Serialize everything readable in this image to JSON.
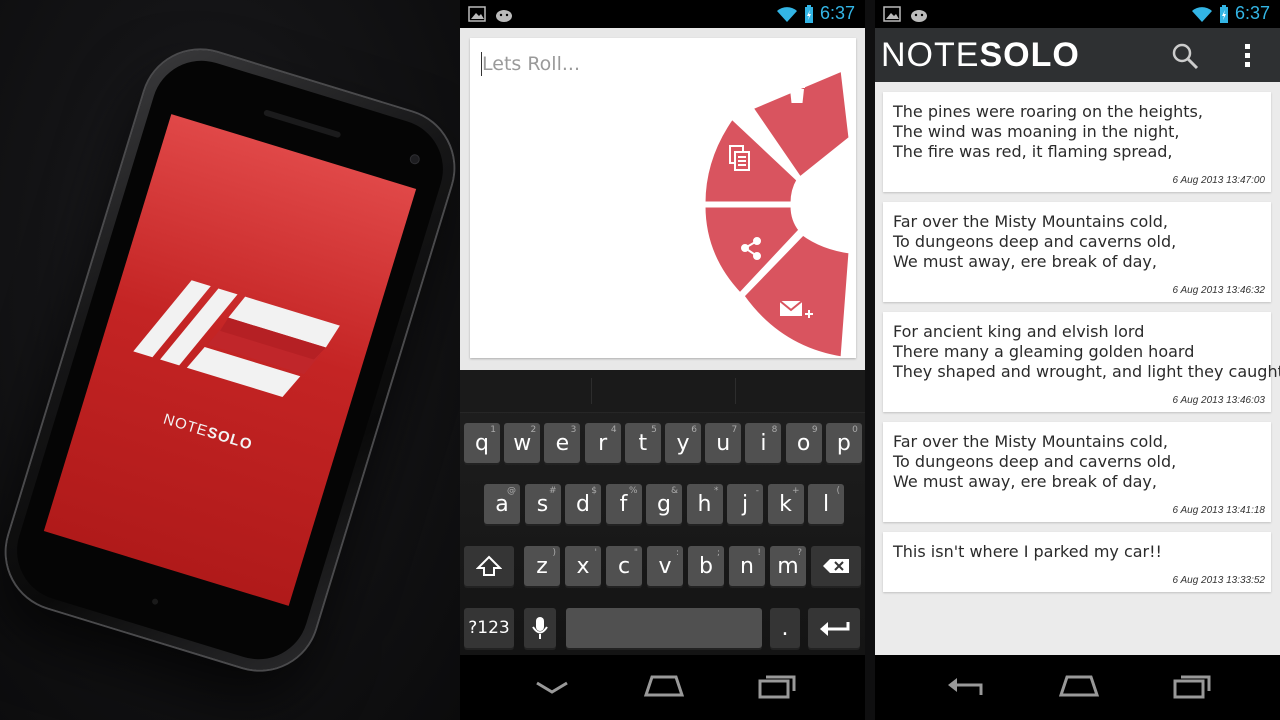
{
  "phone_screen": {
    "brand_light": "NOTE",
    "brand_bold": "SOLO"
  },
  "status_bar": {
    "time": "6:37"
  },
  "editor": {
    "placeholder": "Lets Roll...",
    "radial_menu": [
      "trash-icon",
      "copy-icon",
      "share-icon",
      "email-add-icon"
    ]
  },
  "keyboard": {
    "row1": [
      {
        "k": "q",
        "s": "1"
      },
      {
        "k": "w",
        "s": "2"
      },
      {
        "k": "e",
        "s": "3"
      },
      {
        "k": "r",
        "s": "4"
      },
      {
        "k": "t",
        "s": "5"
      },
      {
        "k": "y",
        "s": "6"
      },
      {
        "k": "u",
        "s": "7"
      },
      {
        "k": "i",
        "s": "8"
      },
      {
        "k": "o",
        "s": "9"
      },
      {
        "k": "p",
        "s": "0"
      }
    ],
    "row2": [
      {
        "k": "a",
        "s": "@"
      },
      {
        "k": "s",
        "s": "#"
      },
      {
        "k": "d",
        "s": "$"
      },
      {
        "k": "f",
        "s": "%"
      },
      {
        "k": "g",
        "s": "&"
      },
      {
        "k": "h",
        "s": "*"
      },
      {
        "k": "j",
        "s": "-"
      },
      {
        "k": "k",
        "s": "+"
      },
      {
        "k": "l",
        "s": "("
      }
    ],
    "row3": [
      {
        "k": "z",
        "s": ")"
      },
      {
        "k": "x",
        "s": "'"
      },
      {
        "k": "c",
        "s": "\""
      },
      {
        "k": "v",
        "s": ":"
      },
      {
        "k": "b",
        "s": ";"
      },
      {
        "k": "n",
        "s": "!"
      },
      {
        "k": "m",
        "s": "?"
      }
    ],
    "symbols_label": "?123",
    "period_label": "."
  },
  "list_app": {
    "title_light": "NOTE",
    "title_bold": "SOLO",
    "notes": [
      {
        "text": "The pines were roaring on the heights,\nThe wind was moaning in the night,\nThe fire was red, it flaming spread,",
        "date": "6 Aug 2013 13:47:00"
      },
      {
        "text": "Far over the Misty Mountains cold,\nTo dungeons deep and caverns old,\nWe must away, ere break of day,",
        "date": "6 Aug 2013 13:46:32"
      },
      {
        "text": "For ancient king and elvish lord\nThere many a gleaming golden hoard\nThey shaped and wrought, and light they caught,",
        "date": "6 Aug 2013 13:46:03"
      },
      {
        "text": "Far over the Misty Mountains cold,\nTo dungeons deep and caverns old,\nWe must away, ere break of day,",
        "date": "6 Aug 2013 13:41:18"
      },
      {
        "text": "This isn't where I parked my car!!",
        "date": "6 Aug 2013 13:33:52"
      }
    ]
  },
  "colors": {
    "accent_red": "#d9545f",
    "status_blue": "#33b5e5",
    "action_bar": "#2e3032"
  }
}
